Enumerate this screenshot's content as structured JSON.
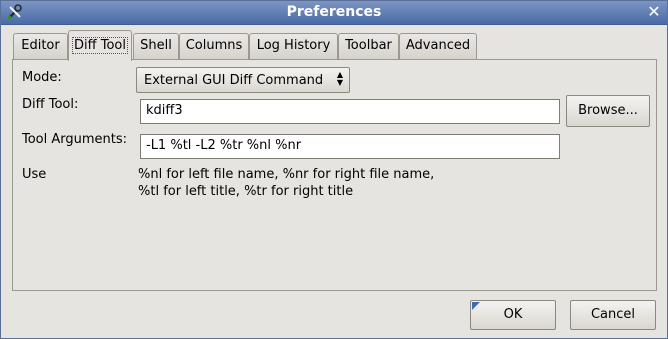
{
  "window": {
    "title": "Preferences"
  },
  "tabs": [
    "Editor",
    "Diff Tool",
    "Shell",
    "Columns",
    "Log History",
    "Toolbar",
    "Advanced"
  ],
  "active_tab": "Diff Tool",
  "mode": {
    "label": "Mode:",
    "value": "External GUI Diff Command"
  },
  "diff_tool": {
    "label": "Diff Tool:",
    "value": "kdiff3",
    "browse_label": "Browse..."
  },
  "tool_args": {
    "label": "Tool Arguments:",
    "value": "-L1 %tl -L2 %tr %nl %nr"
  },
  "help": {
    "label": "Use",
    "line1": "%nl for left file name, %nr for right file name,",
    "line2": "%tl for left title, %tr for right title"
  },
  "footer": {
    "ok_label": "OK",
    "cancel_label": "Cancel"
  }
}
